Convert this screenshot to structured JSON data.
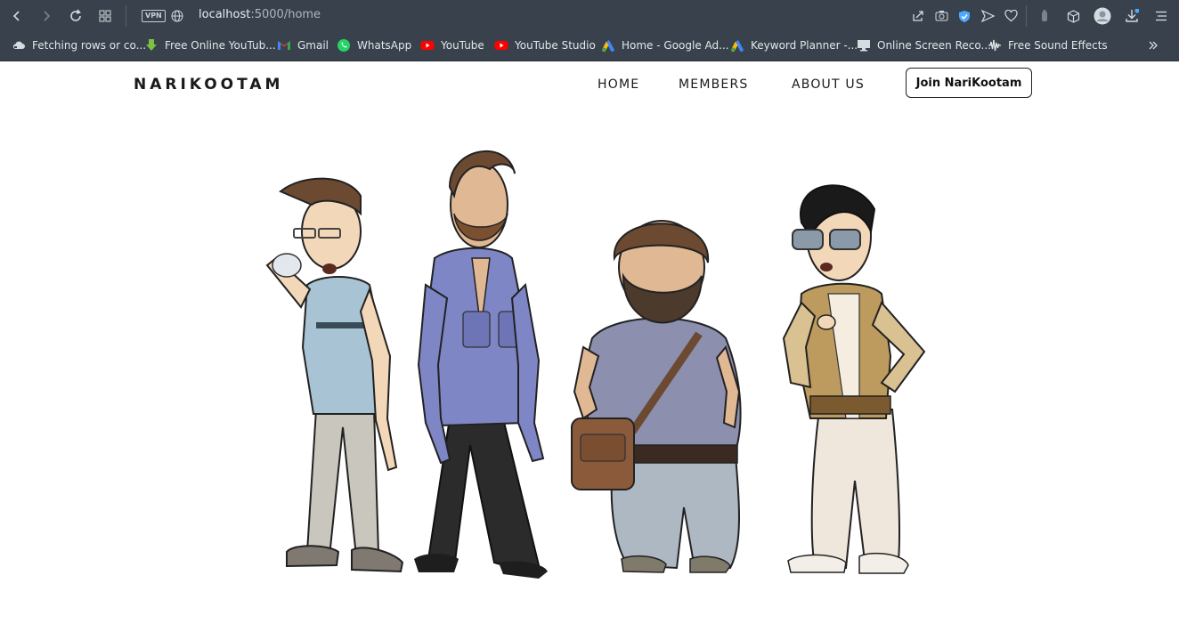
{
  "browser": {
    "url_host": "localhost",
    "url_path": ":5000/home",
    "vpn_label": "VPN",
    "bookmarks": [
      {
        "label": "Fetching rows or co...",
        "icon": "cloud-icon"
      },
      {
        "label": "Free Online YouTub...",
        "icon": "download-arrow-icon"
      },
      {
        "label": "Gmail",
        "icon": "gmail-icon"
      },
      {
        "label": "WhatsApp",
        "icon": "whatsapp-icon"
      },
      {
        "label": "YouTube",
        "icon": "youtube-icon"
      },
      {
        "label": "YouTube Studio",
        "icon": "youtube-studio-icon"
      },
      {
        "label": "Home - Google Ad...",
        "icon": "google-ads-icon"
      },
      {
        "label": "Keyword Planner -...",
        "icon": "google-ads-icon"
      },
      {
        "label": "Online Screen Reco...",
        "icon": "monitor-icon"
      },
      {
        "label": "Free Sound Effects",
        "icon": "waveform-icon"
      }
    ]
  },
  "site": {
    "brand": "NARIKOOTAM",
    "nav": [
      "HOME",
      "MEMBERS",
      "ABOUT US"
    ],
    "cta": "Join NariKootam"
  },
  "colors": {
    "chrome_bg": "#38414c",
    "accent_blue": "#4ea8ff",
    "shirt1": "#a8c4d4",
    "shirt2": "#7e86c6",
    "shirt3": "#8d8fae",
    "jacket4": "#bd9a5d"
  }
}
